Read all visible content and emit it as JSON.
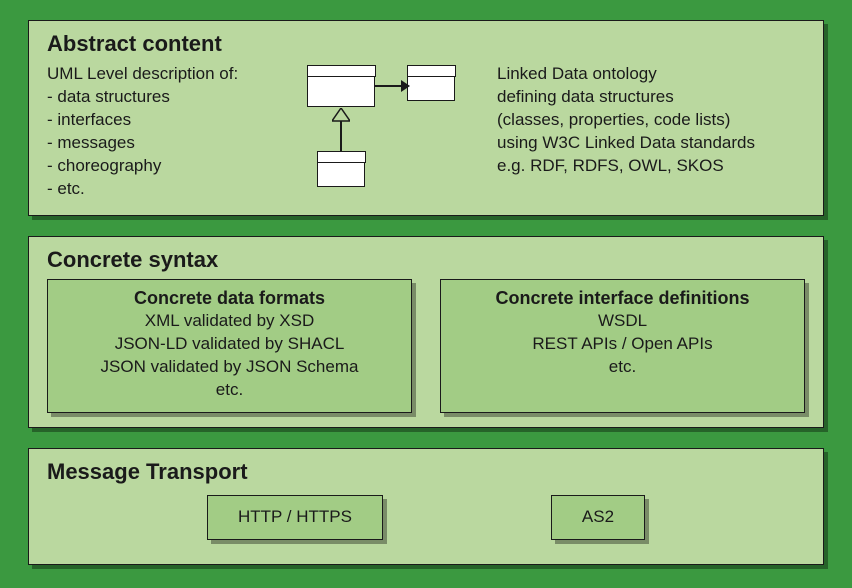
{
  "tier1": {
    "title": "Abstract content",
    "left_heading": "UML Level description of:",
    "left_item1": "- data structures",
    "left_item2": "- interfaces",
    "left_item3": "- messages",
    "left_item4": "- choreography",
    "left_item5": "- etc.",
    "right_line1": "Linked Data ontology",
    "right_line2": "defining data structures",
    "right_line3": "(classes, properties, code lists)",
    "right_line4": "using W3C Linked Data standards",
    "right_line5": "e.g. RDF, RDFS, OWL, SKOS"
  },
  "tier2": {
    "title": "Concrete syntax",
    "box1_title": "Concrete data formats",
    "box1_line1": "XML validated by XSD",
    "box1_line2": "JSON-LD validated by SHACL",
    "box1_line3": "JSON validated by JSON Schema",
    "box1_line4": "etc.",
    "box2_title": "Concrete interface definitions",
    "box2_line1": "WSDL",
    "box2_line2": "REST APIs / Open APIs",
    "box2_line3": "etc."
  },
  "tier3": {
    "title": "Message Transport",
    "box1": "HTTP / HTTPS",
    "box2": "AS2"
  }
}
